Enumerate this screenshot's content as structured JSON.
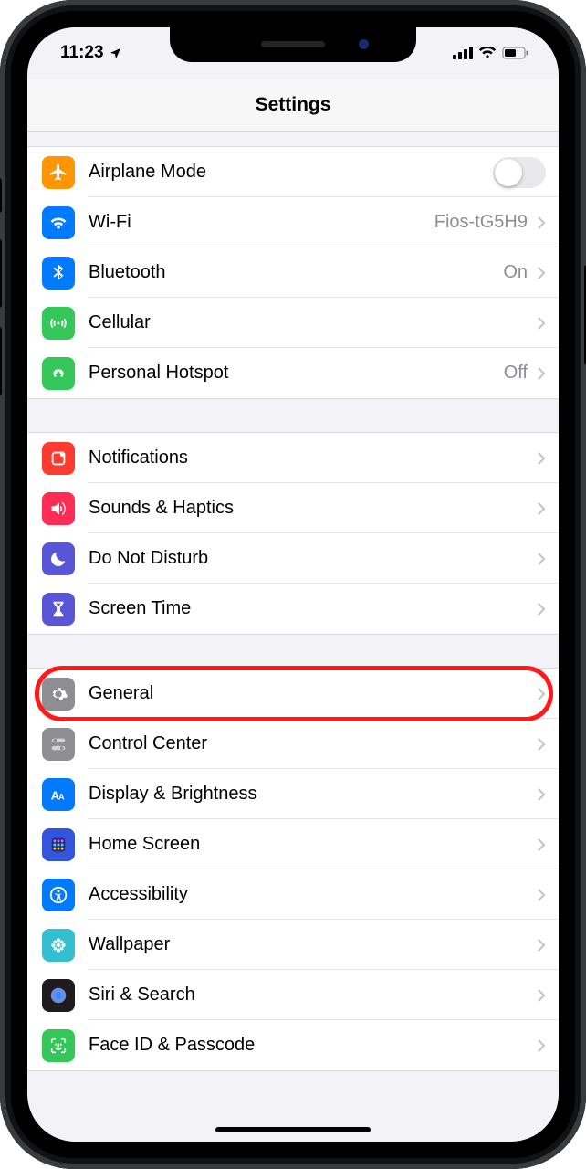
{
  "status": {
    "time": "11:23",
    "location_icon": "location-arrow-icon",
    "cell_bars": 4,
    "wifi_bars": 3,
    "battery_pct": 55
  },
  "header": {
    "title": "Settings"
  },
  "groups": [
    {
      "id": "connectivity",
      "rows": [
        {
          "id": "airplane",
          "icon": "airplane-icon",
          "icon_bg": "#ff9500",
          "label": "Airplane Mode",
          "control": "toggle",
          "toggle_on": false
        },
        {
          "id": "wifi",
          "icon": "wifi-icon",
          "icon_bg": "#007aff",
          "label": "Wi-Fi",
          "value": "Fios-tG5H9",
          "chevron": true
        },
        {
          "id": "bluetooth",
          "icon": "bluetooth-icon",
          "icon_bg": "#007aff",
          "label": "Bluetooth",
          "value": "On",
          "chevron": true
        },
        {
          "id": "cellular",
          "icon": "antenna-icon",
          "icon_bg": "#34c759",
          "label": "Cellular",
          "chevron": true
        },
        {
          "id": "hotspot",
          "icon": "hotspot-icon",
          "icon_bg": "#34c759",
          "label": "Personal Hotspot",
          "value": "Off",
          "chevron": true
        }
      ]
    },
    {
      "id": "alerts",
      "rows": [
        {
          "id": "notifications",
          "icon": "notifications-icon",
          "icon_bg": "#ff3b30",
          "label": "Notifications",
          "chevron": true
        },
        {
          "id": "sounds",
          "icon": "sounds-icon",
          "icon_bg": "#ff2d55",
          "label": "Sounds & Haptics",
          "chevron": true
        },
        {
          "id": "dnd",
          "icon": "moon-icon",
          "icon_bg": "#5856d6",
          "label": "Do Not Disturb",
          "chevron": true
        },
        {
          "id": "screentime",
          "icon": "hourglass-icon",
          "icon_bg": "#5856d6",
          "label": "Screen Time",
          "chevron": true
        }
      ]
    },
    {
      "id": "device",
      "rows": [
        {
          "id": "general",
          "icon": "gear-icon",
          "icon_bg": "#8e8e93",
          "label": "General",
          "chevron": true,
          "highlight": true
        },
        {
          "id": "controlcenter",
          "icon": "switches-icon",
          "icon_bg": "#8e8e93",
          "label": "Control Center",
          "chevron": true
        },
        {
          "id": "display",
          "icon": "textsize-icon",
          "icon_bg": "#027aff",
          "label": "Display & Brightness",
          "chevron": true
        },
        {
          "id": "homescreen",
          "icon": "grid-icon",
          "icon_bg": "#3355dd",
          "label": "Home Screen",
          "chevron": true
        },
        {
          "id": "accessibility",
          "icon": "accessibility-icon",
          "icon_bg": "#007aff",
          "label": "Accessibility",
          "chevron": true
        },
        {
          "id": "wallpaper",
          "icon": "flower-icon",
          "icon_bg": "#34bed0",
          "label": "Wallpaper",
          "chevron": true
        },
        {
          "id": "siri",
          "icon": "siri-icon",
          "icon_bg": "#1c1c1e",
          "label": "Siri & Search",
          "chevron": true
        },
        {
          "id": "faceid",
          "icon": "faceid-icon",
          "icon_bg": "#34c759",
          "label": "Face ID & Passcode",
          "chevron": true
        }
      ]
    }
  ]
}
